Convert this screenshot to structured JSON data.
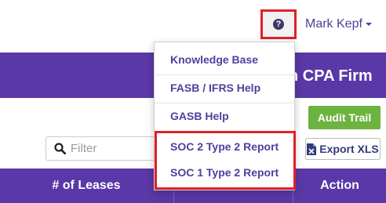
{
  "header": {
    "help_icon": "question-circle-icon",
    "user_name": "Mark Kepf",
    "user_caret_icon": "caret-down-icon"
  },
  "banner": {
    "title_fragment": "n CPA Firm"
  },
  "toolbar": {
    "audit_trail_label": "Audit Trail",
    "filter_placeholder": "Filter",
    "filter_value": "",
    "filter_icon": "search-icon",
    "export_label": "Export XLS",
    "export_icon": "file-excel-icon"
  },
  "table": {
    "headers": [
      "# of Leases",
      "Action"
    ]
  },
  "help_menu": {
    "items": [
      {
        "label": "Knowledge Base"
      },
      {
        "label": "FASB / IFRS Help"
      },
      {
        "label": "GASB Help"
      },
      {
        "label": "SOC 2 Type 2 Report"
      },
      {
        "label": "SOC 1 Type 2 Report"
      }
    ]
  },
  "colors": {
    "brand_purple": "#5a38a7",
    "link_purple": "#4f3f9c",
    "audit_green": "#6db33f",
    "highlight_red": "#e0202a"
  }
}
